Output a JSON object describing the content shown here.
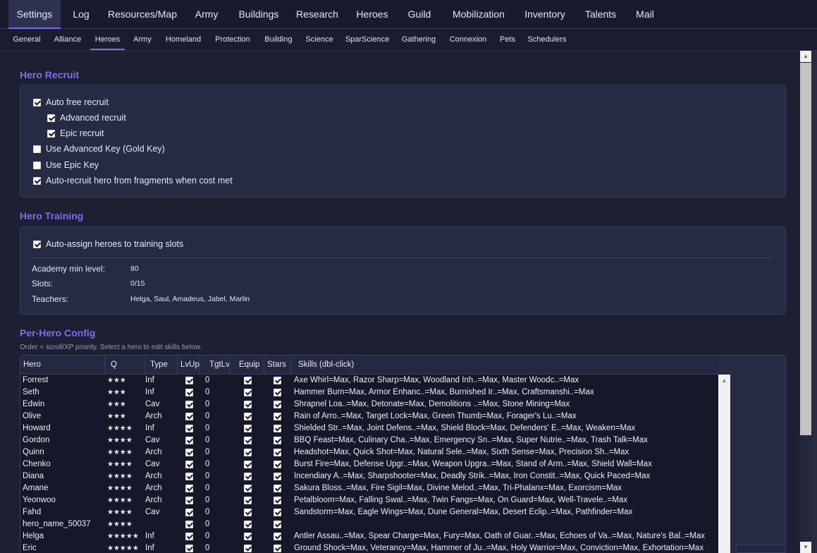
{
  "top_tabs": [
    {
      "label": "Settings",
      "active": true
    },
    {
      "label": "Log"
    },
    {
      "label": "Resources/Map"
    },
    {
      "label": "Army"
    },
    {
      "label": "Buildings"
    },
    {
      "label": "Research"
    },
    {
      "label": "Heroes"
    },
    {
      "label": "Guild"
    },
    {
      "label": "Mobilization"
    },
    {
      "label": "Inventory"
    },
    {
      "label": "Talents"
    },
    {
      "label": "Mail"
    }
  ],
  "sub_tabs": [
    {
      "label": "General"
    },
    {
      "label": "Alliance"
    },
    {
      "label": "Heroes",
      "active": true
    },
    {
      "label": "Army"
    },
    {
      "label": "Homeland"
    },
    {
      "label": "Protection"
    },
    {
      "label": "Building"
    },
    {
      "label": "Science"
    },
    {
      "label": "SparScience"
    },
    {
      "label": "Gathering"
    },
    {
      "label": "Connexion"
    },
    {
      "label": "Pets"
    },
    {
      "label": "Schedulers"
    }
  ],
  "hero_recruit": {
    "title": "Hero Recruit",
    "options": [
      {
        "label": "Auto free recruit",
        "checked": true
      },
      {
        "label": "Advanced recruit",
        "checked": true
      },
      {
        "label": "Epic recruit",
        "checked": true
      },
      {
        "label": "Use Advanced Key (Gold Key)",
        "checked": false
      },
      {
        "label": "Use Epic Key",
        "checked": false
      },
      {
        "label": "Auto-recruit hero from fragments when cost met",
        "checked": true
      }
    ]
  },
  "hero_training": {
    "title": "Hero Training",
    "auto_assign": {
      "label": "Auto-assign heroes to training slots",
      "checked": true
    },
    "academy_min_level": {
      "label": "Academy min level:",
      "value": "80"
    },
    "slots": {
      "label": "Slots:",
      "value": "0/15"
    },
    "teachers": {
      "label": "Teachers:",
      "value": "Helga, Saul, Amadeus, Jabel, Marlin"
    }
  },
  "per_hero": {
    "title": "Per-Hero Config",
    "hint": "Order = scroll/XP priority. Select a hero to edit skills below.",
    "columns": [
      "Hero",
      "Q",
      "Type",
      "LvUp",
      "TgtLv",
      "Equip",
      "Stars",
      "Skills (dbl-click)"
    ],
    "rows": [
      {
        "hero": "Forrest",
        "q": "★★★",
        "type": "Inf",
        "lvup": true,
        "tgtlv": "0",
        "equip": true,
        "stars": true,
        "skills": "Axe Whirl=Max, Razor Sharp=Max, Woodland Inh..=Max, Master Woodc..=Max"
      },
      {
        "hero": "Seth",
        "q": "★★★",
        "type": "Inf",
        "lvup": true,
        "tgtlv": "0",
        "equip": true,
        "stars": true,
        "skills": "Hammer Burn=Max, Armor Enhanc..=Max, Burnished Ir..=Max, Craftsmanshi..=Max"
      },
      {
        "hero": "Edwin",
        "q": "★★★",
        "type": "Cav",
        "lvup": true,
        "tgtlv": "0",
        "equip": true,
        "stars": true,
        "skills": "Shrapnel Loa..=Max, Detonate=Max, Demolitions ..=Max, Stone Mining=Max"
      },
      {
        "hero": "Olive",
        "q": "★★★",
        "type": "Arch",
        "lvup": true,
        "tgtlv": "0",
        "equip": true,
        "stars": true,
        "skills": "Rain of Arro..=Max, Target Lock=Max, Green Thumb=Max, Forager's Lu..=Max"
      },
      {
        "hero": "Howard",
        "q": "★★★★",
        "type": "Inf",
        "lvup": true,
        "tgtlv": "0",
        "equip": true,
        "stars": true,
        "skills": "Shielded Str..=Max, Joint Defens..=Max, Shield Block=Max, Defenders' E..=Max, Weaken=Max"
      },
      {
        "hero": "Gordon",
        "q": "★★★★",
        "type": "Cav",
        "lvup": true,
        "tgtlv": "0",
        "equip": true,
        "stars": true,
        "skills": "BBQ Feast=Max, Culinary Cha..=Max, Emergency Sn..=Max, Super Nutrie..=Max, Trash Talk=Max"
      },
      {
        "hero": "Quinn",
        "q": "★★★★",
        "type": "Arch",
        "lvup": true,
        "tgtlv": "0",
        "equip": true,
        "stars": true,
        "skills": "Headshot=Max, Quick Shot=Max, Natural Sele..=Max, Sixth Sense=Max, Precision Sh..=Max"
      },
      {
        "hero": "Chenko",
        "q": "★★★★",
        "type": "Cav",
        "lvup": true,
        "tgtlv": "0",
        "equip": true,
        "stars": true,
        "skills": "Burst Fire=Max, Defense Upgr..=Max, Weapon Upgra..=Max, Stand of Arm..=Max, Shield Wall=Max"
      },
      {
        "hero": "Diana",
        "q": "★★★★",
        "type": "Arch",
        "lvup": true,
        "tgtlv": "0",
        "equip": true,
        "stars": true,
        "skills": "Incendiary A..=Max, Sharpshooter=Max, Deadly Strik..=Max, Iron Constit..=Max, Quick Paced=Max"
      },
      {
        "hero": "Amane",
        "q": "★★★★",
        "type": "Arch",
        "lvup": true,
        "tgtlv": "0",
        "equip": true,
        "stars": true,
        "skills": "Sakura Bloss..=Max, Fire Sigil=Max, Divine Melod..=Max, Tri-Phalanx=Max, Exorcism=Max"
      },
      {
        "hero": "Yeonwoo",
        "q": "★★★★",
        "type": "Arch",
        "lvup": true,
        "tgtlv": "0",
        "equip": true,
        "stars": true,
        "skills": "Petalbloom=Max, Falling Swal..=Max, Twin Fangs=Max, On Guard=Max, Well-Travele..=Max"
      },
      {
        "hero": "Fahd",
        "q": "★★★★",
        "type": "Cav",
        "lvup": true,
        "tgtlv": "0",
        "equip": true,
        "stars": true,
        "skills": "Sandstorm=Max, Eagle Wings=Max, Dune General=Max, Desert Eclip..=Max, Pathfinder=Max"
      },
      {
        "hero": "hero_name_50037",
        "q": "★★★★",
        "type": "",
        "lvup": true,
        "tgtlv": "0",
        "equip": true,
        "stars": true,
        "skills": ""
      },
      {
        "hero": "Helga",
        "q": "★★★★★",
        "type": "Inf",
        "lvup": true,
        "tgtlv": "0",
        "equip": true,
        "stars": true,
        "skills": "Antler Assau..=Max, Spear Charge=Max, Fury=Max, Oath of Guar..=Max, Echoes of Va..=Max, Nature's Bal..=Max"
      },
      {
        "hero": "Eric",
        "q": "★★★★★",
        "type": "Inf",
        "lvup": true,
        "tgtlv": "0",
        "equip": true,
        "stars": true,
        "skills": "Ground Shock=Max, Veterancy=Max, Hammer of Ju..=Max, Holy Warrior=Max, Conviction=Max, Exhortation=Max"
      }
    ]
  },
  "colors": {
    "accent": "#7b6dea",
    "section_title": "#7d6ff0",
    "background": "#1d1f33",
    "card": "#272a43"
  },
  "icons": {
    "checkbox": "checkbox-icon",
    "scroll_up": "chevron-up-icon",
    "scroll_down": "chevron-down-icon"
  }
}
